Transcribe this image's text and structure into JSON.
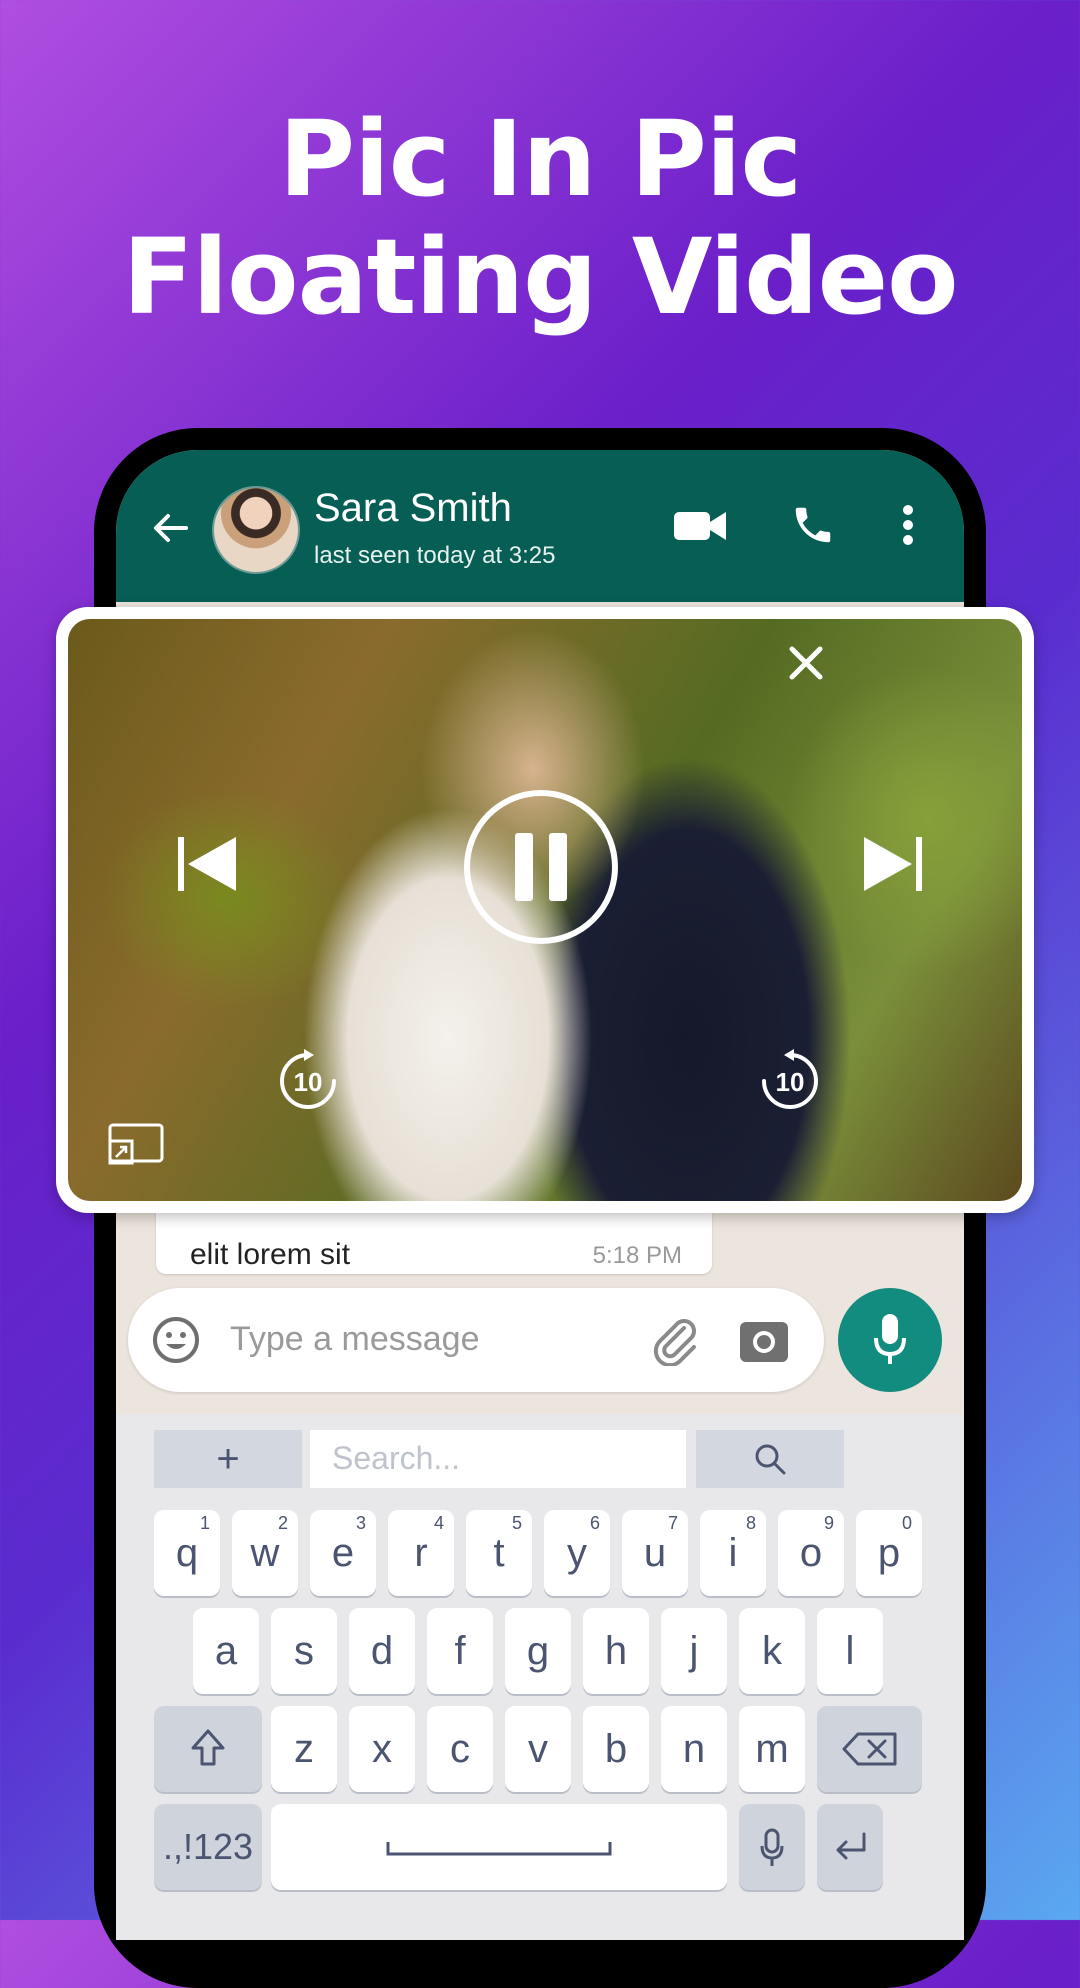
{
  "headline": {
    "line1": "Pic In Pic",
    "line2": "Floating Video"
  },
  "chat": {
    "contact_name": "Sara Smith",
    "status": "last seen today at 3:25",
    "message_partial": "elit lorem sit",
    "message_time": "5:18 PM"
  },
  "input": {
    "placeholder": "Type a message"
  },
  "keyboard": {
    "plus": "+",
    "search_placeholder": "Search...",
    "row1": [
      {
        "k": "q",
        "n": "1"
      },
      {
        "k": "w",
        "n": "2"
      },
      {
        "k": "e",
        "n": "3"
      },
      {
        "k": "r",
        "n": "4"
      },
      {
        "k": "t",
        "n": "5"
      },
      {
        "k": "y",
        "n": "6"
      },
      {
        "k": "u",
        "n": "7"
      },
      {
        "k": "i",
        "n": "8"
      },
      {
        "k": "o",
        "n": "9"
      },
      {
        "k": "p",
        "n": "0"
      }
    ],
    "row2": [
      "a",
      "s",
      "d",
      "f",
      "g",
      "h",
      "j",
      "k",
      "l"
    ],
    "row3": [
      "z",
      "x",
      "c",
      "v",
      "b",
      "n",
      "m"
    ],
    "symbols": ".,!123"
  },
  "colors": {
    "accent": "#075e54",
    "mic": "#128c7e"
  },
  "icons": [
    "back-arrow",
    "avatar",
    "video-call",
    "phone",
    "more-vert",
    "close",
    "skip-previous",
    "pause",
    "skip-next",
    "replay-10",
    "forward-10",
    "pip-expand",
    "emoji",
    "attach",
    "camera",
    "mic",
    "search",
    "shift",
    "backspace",
    "enter"
  ]
}
